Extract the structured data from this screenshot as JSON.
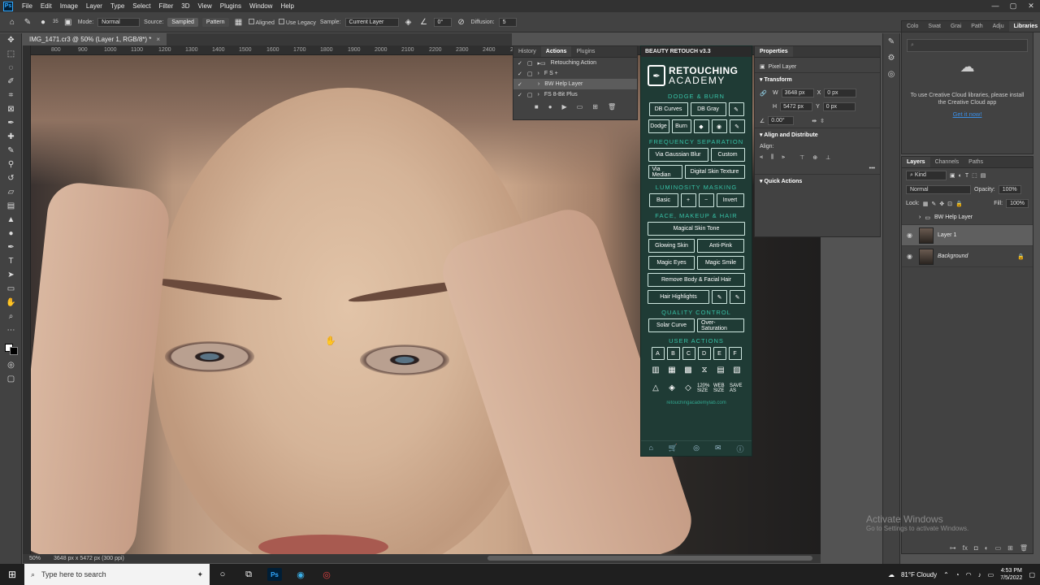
{
  "menubar": {
    "items": [
      "File",
      "Edit",
      "Image",
      "Layer",
      "Type",
      "Select",
      "Filter",
      "3D",
      "View",
      "Plugins",
      "Window",
      "Help"
    ],
    "logo": "Ps"
  },
  "options": {
    "brush_size": "35",
    "mode_label": "Mode:",
    "mode_value": "Normal",
    "source_label": "Source:",
    "sampled": "Sampled",
    "pattern": "Pattern",
    "aligned": "Aligned",
    "use_legacy": "Use Legacy",
    "sample_label": "Sample:",
    "sample_value": "Current Layer",
    "angle": "0°",
    "diffusion_label": "Diffusion:",
    "diffusion_value": "5"
  },
  "document": {
    "tab_title": "IMG_1471.cr3 @ 50% (Layer 1, RGB/8*) *",
    "ruler_ticks": [
      "800",
      "900",
      "1000",
      "1100",
      "1200",
      "1300",
      "1400",
      "1500",
      "1600",
      "1700",
      "1800",
      "1900",
      "2000",
      "2100",
      "2200",
      "2300",
      "2400",
      "2500"
    ],
    "zoom": "50%",
    "doc_size": "3648 px x 5472 px (300 ppi)"
  },
  "history_panel": {
    "tabs": [
      "History",
      "Actions",
      "Plugins"
    ],
    "rows": [
      {
        "label": "Retouching Action",
        "selected": false
      },
      {
        "label": "F S +",
        "selected": false
      },
      {
        "label": "BW Help Layer",
        "selected": true
      },
      {
        "label": "FS 8-Bit Plus",
        "selected": false
      }
    ]
  },
  "beauty_retouch": {
    "title": "BEAUTY RETOUCH v3.3",
    "logo_line1": "RETOUCHING",
    "logo_line2": "ACADEMY",
    "sections": {
      "dodge_burn": "DODGE & BURN",
      "freq_sep": "FREQUENCY SEPARATION",
      "lum_mask": "LUMINOSITY MASKING",
      "face": "FACE, MAKEUP & HAIR",
      "quality": "QUALITY CONTROL",
      "user": "USER ACTIONS"
    },
    "buttons": {
      "db_curves": "DB Curves",
      "db_gray": "DB Gray",
      "dodge": "Dodge",
      "burn": "Burn",
      "via_gaussian": "Via Gaussian Blur",
      "custom": "Custom",
      "via_median": "Via Median",
      "digital_skin": "Digital Skin Texture",
      "basic": "Basic",
      "plus": "+",
      "minus": "−",
      "invert": "Invert",
      "magical_skin": "Magical Skin Tone",
      "glowing_skin": "Glowing Skin",
      "anti_pink": "Anti-Pink",
      "magic_eyes": "Magic Eyes",
      "magic_smile": "Magic Smile",
      "remove_hair": "Remove Body & Facial Hair",
      "hair_highlights": "Hair Highlights",
      "solar_curve": "Solar Curve",
      "over_saturation": "Over-Saturation"
    },
    "user_letters": [
      "A",
      "B",
      "C",
      "D",
      "E",
      "F"
    ],
    "size_labels": [
      "120% SIZE",
      "WEB SIZE",
      "SAVE AS"
    ],
    "url": "retouchingacademylab.com"
  },
  "properties": {
    "tab": "Properties",
    "layer_type": "Pixel Layer",
    "transform": "Transform",
    "w_label": "W",
    "w_value": "3648 px",
    "h_label": "H",
    "h_value": "5472 px",
    "x_label": "X",
    "x_value": "0 px",
    "y_label": "Y",
    "y_value": "0 px",
    "angle_value": "0.00°",
    "align": "Align and Distribute",
    "align_label": "Align:",
    "quick_actions": "Quick Actions"
  },
  "libraries": {
    "tabs": [
      "Colo",
      "Swat",
      "Grai",
      "Path",
      "Adju",
      "Libraries"
    ],
    "message": "To use Creative Cloud libraries, please install the Creative Cloud app",
    "link": "Get it now!"
  },
  "layers": {
    "tabs": [
      "Layers",
      "Channels",
      "Paths"
    ],
    "kind": "Kind",
    "blend": "Normal",
    "opacity_label": "Opacity:",
    "opacity": "100%",
    "lock_label": "Lock:",
    "fill_label": "Fill:",
    "fill": "100%",
    "rows": [
      {
        "name": "BW Help Layer",
        "type": "group"
      },
      {
        "name": "Layer 1",
        "type": "layer"
      },
      {
        "name": "Background",
        "type": "layer"
      }
    ]
  },
  "watermark": {
    "line1": "Activate Windows",
    "line2": "Go to Settings to activate Windows."
  },
  "taskbar": {
    "search_placeholder": "Type here to search",
    "weather": "81°F  Cloudy",
    "time": "4:53 PM",
    "date": "7/5/2022"
  }
}
